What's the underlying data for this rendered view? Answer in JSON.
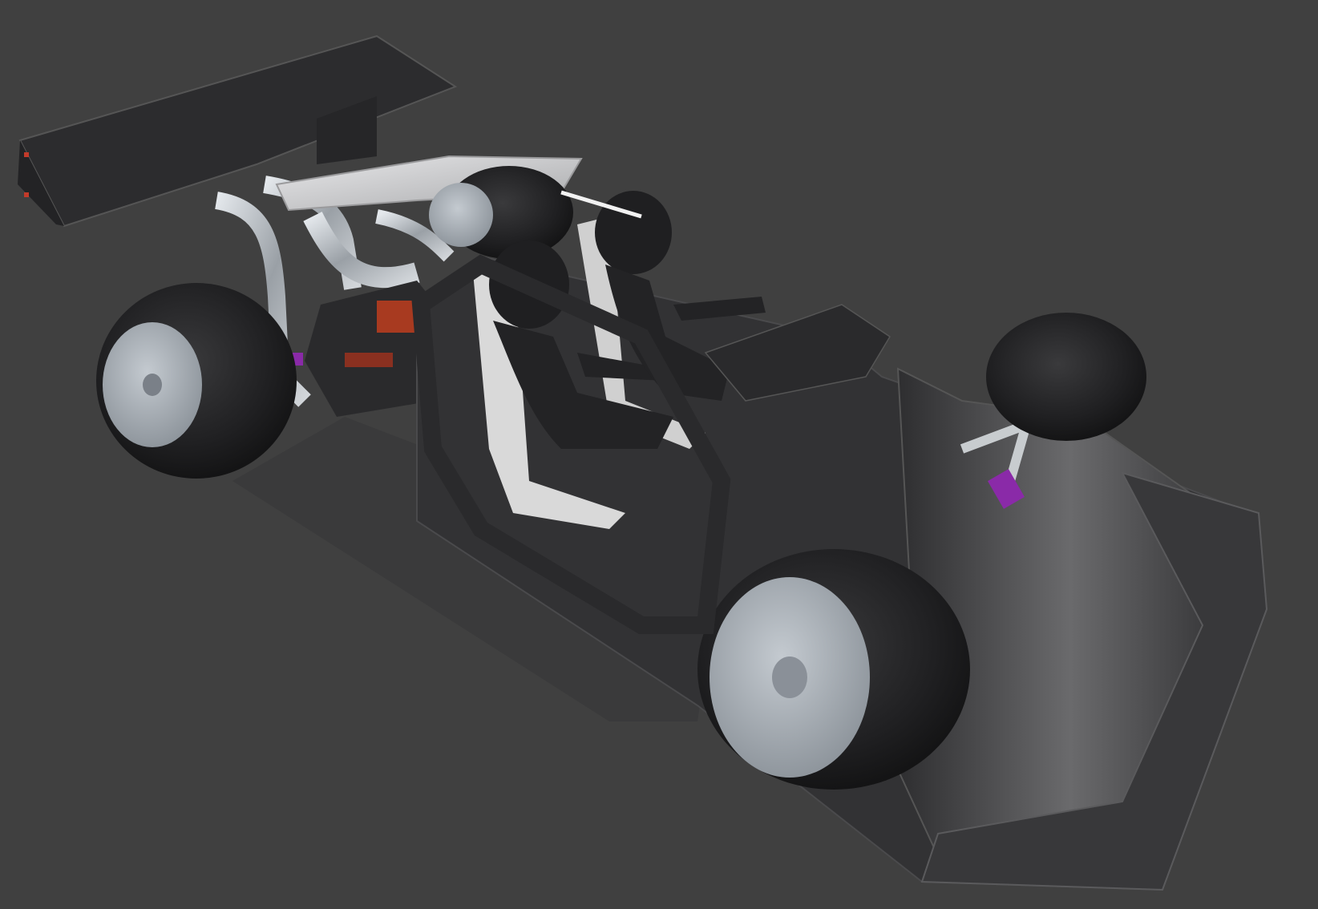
{
  "viewport": {
    "background_color": "#404040"
  },
  "model": {
    "body_color": "#3a3a3c",
    "tire_color": "#1e1e20",
    "rim_color": "#a9b0b8",
    "pipe_color": "#b8bec4",
    "engine_accent_color": "#a83a20",
    "spring_color": "#8a2aa8",
    "helmet_color": "#1f1f21",
    "seat_color": "#d9d9d9",
    "wing_color": "#2c2c2e",
    "engine_cover_color": "#cfd0d2"
  }
}
